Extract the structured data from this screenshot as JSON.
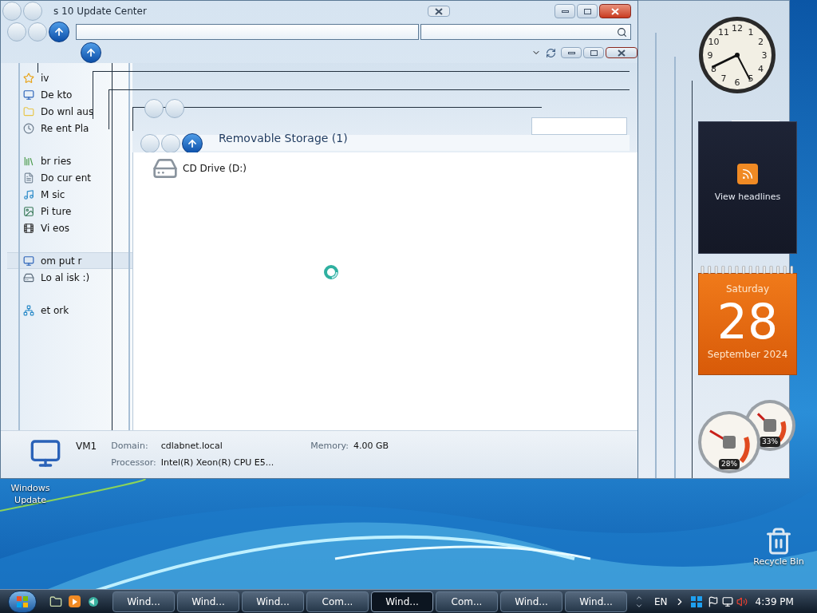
{
  "window": {
    "title": "s 10 Update Center"
  },
  "sidebar": {
    "groups": [
      {
        "items": [
          {
            "label": "iv",
            "selected": false
          },
          {
            "label": "De kto",
            "selected": false
          },
          {
            "label": "Do wnl aus",
            "selected": false
          },
          {
            "label": "Re ent Pla",
            "selected": false
          }
        ]
      },
      {
        "items": [
          {
            "label": "br ries",
            "selected": false
          },
          {
            "label": "Do cur ent",
            "selected": false
          },
          {
            "label": "M sic",
            "selected": false
          },
          {
            "label": "Pi ture",
            "selected": false
          },
          {
            "label": "Vi eos",
            "selected": false
          }
        ]
      },
      {
        "items": [
          {
            "label": "om put r",
            "selected": true
          },
          {
            "label": "Lo al isk :)",
            "selected": false
          }
        ]
      },
      {
        "items": [
          {
            "label": "et ork",
            "selected": false
          }
        ]
      }
    ]
  },
  "content": {
    "group_header": "Removable Storage (1)",
    "items": [
      {
        "label": "CD Drive (D:)"
      }
    ]
  },
  "details": {
    "name": "VM1",
    "fields": [
      {
        "label": "Domain:",
        "value": "cdlabnet.local"
      },
      {
        "label": "Memory:",
        "value": "4.00 GB"
      },
      {
        "label": "Processor:",
        "value": "Intel(R) Xeon(R) CPU E5..."
      }
    ]
  },
  "desktop_icons": [
    {
      "label": "Windows Update"
    },
    {
      "label": "Recycle Bin"
    }
  ],
  "gadgets": {
    "clock": {
      "numerals": [
        "11",
        "12",
        "1",
        "10",
        "2",
        "9",
        "3",
        "8",
        "4",
        "7",
        "6",
        "5"
      ]
    },
    "feed": {
      "label": "View headlines"
    },
    "calendar": {
      "weekday": "Saturday",
      "day": "28",
      "month_year": "September 2024"
    },
    "cpu_meter": {
      "dials": [
        {
          "reading": "28%"
        },
        {
          "reading": "33%"
        }
      ]
    }
  },
  "taskbar": {
    "tasks": [
      {
        "label": "Wind...",
        "selected": false
      },
      {
        "label": "Wind...",
        "selected": false
      },
      {
        "label": "Wind...",
        "selected": false
      },
      {
        "label": "Com...",
        "selected": false
      },
      {
        "label": "Wind...",
        "selected": true
      },
      {
        "label": "Com...",
        "selected": false
      },
      {
        "label": "Wind...",
        "selected": false
      },
      {
        "label": "Wind...",
        "selected": false
      }
    ],
    "language": "EN",
    "time": "4:39 PM"
  }
}
